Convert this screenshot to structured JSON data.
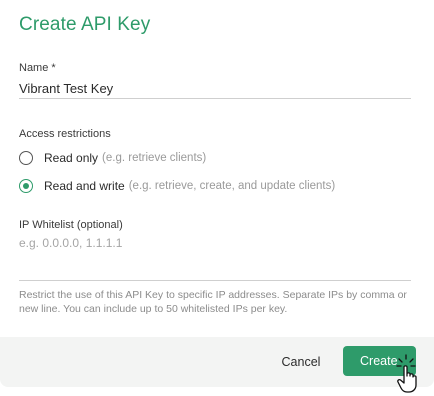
{
  "dialog": {
    "title": "Create API Key",
    "name_label": "Name *",
    "name_value": "Vibrant Test Key",
    "access_label": "Access restrictions",
    "options": [
      {
        "label": "Read only",
        "hint": "(e.g. retrieve clients)",
        "checked": false
      },
      {
        "label": "Read and write",
        "hint": "(e.g. retrieve, create, and update clients)",
        "checked": true
      }
    ],
    "ip_label": "IP Whitelist (optional)",
    "ip_placeholder": "e.g. 0.0.0.0, 1.1.1.1",
    "help_text": "Restrict the use of this API Key to specific IP addresses. Separate IPs by comma or new line. You can include up to 50 whitelisted IPs per key.",
    "cancel_label": "Cancel",
    "create_label": "Create"
  },
  "colors": {
    "accent": "#2e9b6a",
    "footer_bg": "#f3f4f3"
  },
  "icons": {
    "cursor": "hand-pointer-click-icon"
  }
}
